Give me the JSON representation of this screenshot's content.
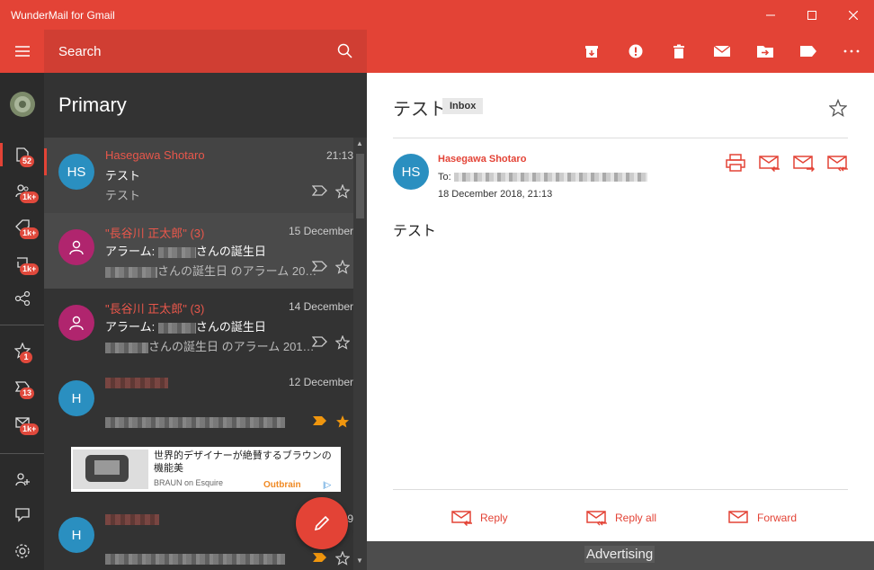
{
  "window": {
    "title": "WunderMail for Gmail"
  },
  "colors": {
    "accent": "#e34336",
    "accent_dark": "#d03e33",
    "sidebar_bg": "#2b2b2b",
    "list_bg": "#333333"
  },
  "search": {
    "label": "Search"
  },
  "folder": {
    "name": "Primary"
  },
  "sidebar": {
    "badges": [
      "52",
      "1k+",
      "1k+",
      "1k+",
      "1",
      "13",
      "1k+"
    ]
  },
  "emails": [
    {
      "initials": "HS",
      "sender": "Hasegawa Shotaro",
      "date": "21:13",
      "subject": "テスト",
      "preview": "テスト",
      "important": false,
      "starred": false,
      "avatar_color": "#2a8fc0"
    },
    {
      "initials": "",
      "sender": "\"長谷川 正太郎\" (3)",
      "date": "15 December",
      "subject_prefix": "アラーム: ",
      "subject_suffix": "さんの誕生日",
      "preview_suffix": "さんの誕生日 のアラーム 20…",
      "important": false,
      "starred": false,
      "avatar_color": "#b0256e"
    },
    {
      "initials": "",
      "sender": "\"長谷川 正太郎\" (3)",
      "date": "14 December",
      "subject_prefix": "アラーム: ",
      "subject_suffix": "さんの誕生日",
      "preview_suffix": "さんの誕生日 のアラーム 201…",
      "important": false,
      "starred": false,
      "avatar_color": "#b0256e"
    },
    {
      "initials": "H",
      "sender": "",
      "date": "12 December",
      "subject": "",
      "preview": "",
      "important": true,
      "starred": true,
      "avatar_color": "#2a8fc0"
    },
    {
      "initials": "H",
      "sender": "",
      "date": "29",
      "subject": "",
      "preview": "",
      "important": true,
      "starred": false,
      "avatar_color": "#2a8fc0"
    }
  ],
  "ad": {
    "headline": "世界的デザイナーが絶賛するブラウンの機能美",
    "source": "BRAUN on Esquire",
    "brand": "Outbrain"
  },
  "message": {
    "subject": "テスト",
    "label": "Inbox",
    "sender": "Hasegawa Shotaro",
    "initials": "HS",
    "to_label": "To:",
    "date": "18 December 2018, 21:13",
    "body": "テスト"
  },
  "actions": {
    "reply": "Reply",
    "reply_all": "Reply all",
    "forward": "Forward"
  },
  "footer": {
    "advertising": "Advertising"
  }
}
